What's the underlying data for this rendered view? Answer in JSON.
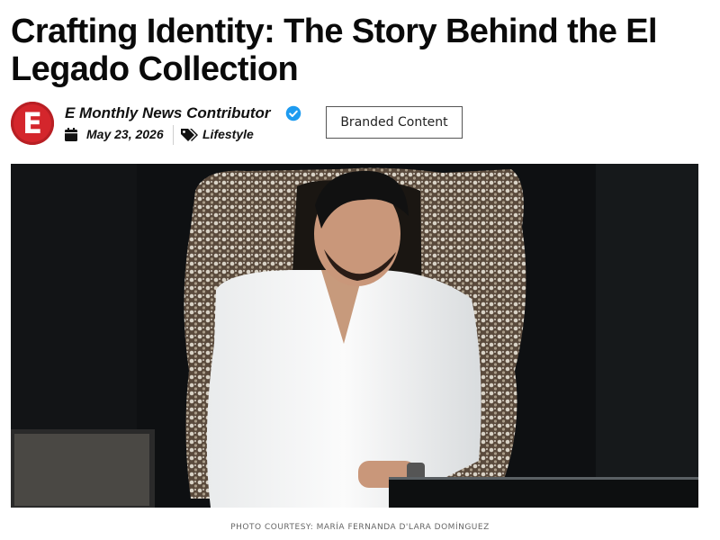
{
  "article": {
    "title": "Crafting Identity: The Story Behind the El Legado Collection",
    "author": "E Monthly News Contributor",
    "date": "May 23, 2026",
    "category": "Lifestyle",
    "badge": "Branded Content",
    "logo_letter": "E",
    "photo_credit": "PHOTO COURTESY: MARÍA FERNANDA D'LARA DOMÍNGUEZ"
  },
  "icons": {
    "verified": "verified-check-icon",
    "calendar": "calendar-icon",
    "tag": "tags-icon"
  },
  "colors": {
    "logo": "#d4262c",
    "verified": "#1d9bf0"
  }
}
